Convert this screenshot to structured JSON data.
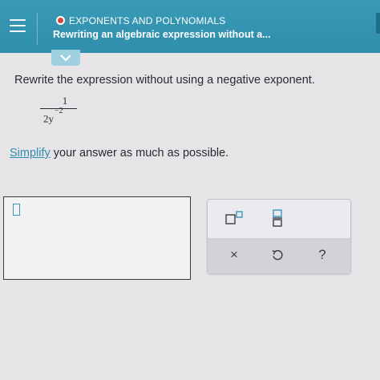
{
  "header": {
    "topic": "EXPONENTS AND POLYNOMIALS",
    "lesson": "Rewriting an algebraic expression without a..."
  },
  "problem": {
    "prompt": "Rewrite the expression without using a negative exponent.",
    "expression": {
      "numerator": "1",
      "denominator_base": "2y",
      "denominator_exponent": "−2"
    },
    "instruction_link": "Simplify",
    "instruction_rest": " your answer as much as possible."
  },
  "answer": {
    "value": ""
  },
  "palette": {
    "buttons": [
      {
        "name": "superscript",
        "icon": "superscript-icon"
      },
      {
        "name": "fraction",
        "icon": "fraction-icon"
      },
      {
        "name": "clear",
        "icon": "clear-icon",
        "label": "×"
      },
      {
        "name": "undo",
        "icon": "undo-icon"
      },
      {
        "name": "help",
        "icon": "help-icon",
        "label": "?"
      }
    ]
  },
  "colors": {
    "header": "#2f8eab",
    "accent": "#3a96b3",
    "topic_dot": "#d6453b",
    "background": "#e6e4e7"
  }
}
